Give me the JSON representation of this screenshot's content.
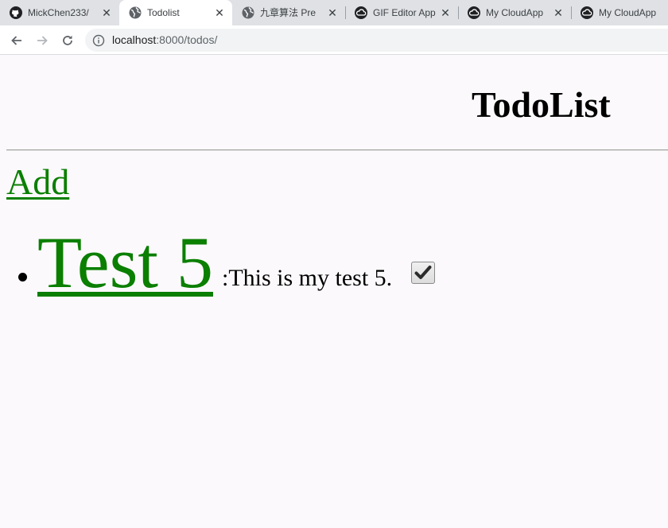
{
  "browser": {
    "tabs": [
      {
        "label": "MickChen233/",
        "icon": "github-icon",
        "active": false
      },
      {
        "label": "Todolist",
        "icon": "globe-icon",
        "active": true
      },
      {
        "label": "九章算法 Pre-",
        "icon": "globe-icon",
        "active": false
      },
      {
        "label": "GIF Editor App",
        "icon": "cloudapp-icon",
        "active": false
      },
      {
        "label": "My CloudApp",
        "icon": "cloudapp-icon",
        "active": false
      },
      {
        "label": "My CloudApp",
        "icon": "cloudapp-icon",
        "active": false
      }
    ],
    "address": {
      "host": "localhost",
      "rest": ":8000/todos/"
    }
  },
  "page": {
    "title": "TodoList",
    "add_link": "Add",
    "todos": [
      {
        "title": "Test 5",
        "description": ":This is my test 5.",
        "completed": true
      }
    ]
  },
  "colors": {
    "link": "#0a7f00",
    "tab_strip": "#dfe1e5",
    "page_bg": "#fbf9fc"
  }
}
